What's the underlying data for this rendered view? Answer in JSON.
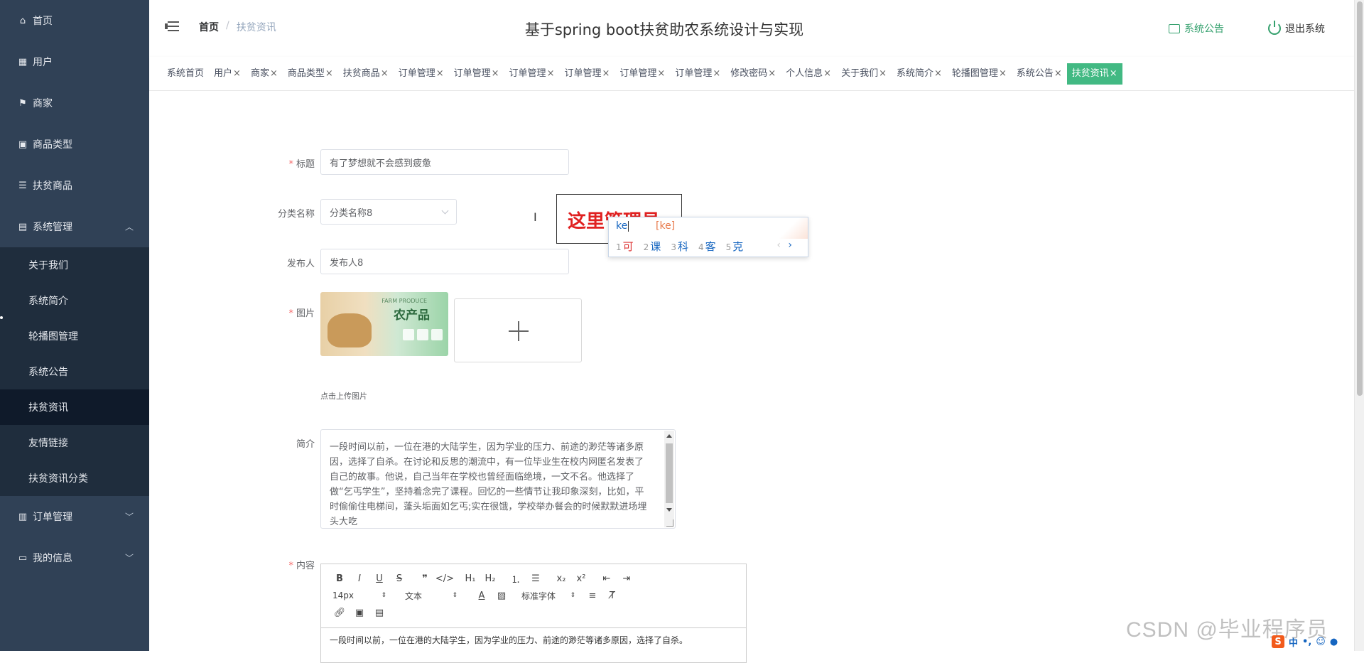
{
  "sidebar": {
    "items": [
      {
        "label": "首页",
        "icon": "home-icon"
      },
      {
        "label": "用户",
        "icon": "grid-icon"
      },
      {
        "label": "商家",
        "icon": "flag-icon"
      },
      {
        "label": "商品类型",
        "icon": "clipboard-icon"
      },
      {
        "label": "扶贫商品",
        "icon": "list-icon"
      },
      {
        "label": "系统管理",
        "icon": "document-icon"
      }
    ],
    "system_sub": [
      "关于我们",
      "系统简介",
      "轮播图管理",
      "系统公告",
      "扶贫资讯",
      "友情链接",
      "扶贫资讯分类"
    ],
    "order": {
      "label": "订单管理",
      "icon": "chart-icon"
    },
    "mine": {
      "label": "我的信息",
      "icon": "wallet-icon"
    }
  },
  "header": {
    "breadcrumb_home": "首页",
    "breadcrumb_sep": "/",
    "breadcrumb_current": "扶贫资讯",
    "title": "基于spring boot扶贫助农系统设计与实现",
    "notice": "系统公告",
    "logout": "退出系统"
  },
  "tabs": [
    {
      "label": "系统首页",
      "closable": false
    },
    {
      "label": "用户",
      "closable": true
    },
    {
      "label": "商家",
      "closable": true
    },
    {
      "label": "商品类型",
      "closable": true
    },
    {
      "label": "扶贫商品",
      "closable": true
    },
    {
      "label": "订单管理",
      "closable": true
    },
    {
      "label": "订单管理",
      "closable": true
    },
    {
      "label": "订单管理",
      "closable": true
    },
    {
      "label": "订单管理",
      "closable": true
    },
    {
      "label": "订单管理",
      "closable": true
    },
    {
      "label": "订单管理",
      "closable": true
    },
    {
      "label": "修改密码",
      "closable": true
    },
    {
      "label": "个人信息",
      "closable": true
    },
    {
      "label": "关于我们",
      "closable": true
    },
    {
      "label": "系统简介",
      "closable": true
    },
    {
      "label": "轮播图管理",
      "closable": true
    },
    {
      "label": "系统公告",
      "closable": true
    },
    {
      "label": "扶贫资讯",
      "closable": true,
      "active": true
    }
  ],
  "tab_close": "×",
  "form": {
    "required_mark": "*",
    "title_label": "标题",
    "title_value": "有了梦想就不会感到疲惫",
    "category_label": "分类名称",
    "category_value": "分类名称8",
    "publisher_label": "发布人",
    "publisher_value": "发布人8",
    "image_label": "图片",
    "image_thumb_title": "农产品",
    "image_thumb_sub": "FARM PRODUCE",
    "upload_hint": "点击上传图片",
    "intro_label": "简介",
    "intro_value": "一段时间以前，一位在港的大陆学生，因为学业的压力、前途的渺茫等诸多原因，选择了自杀。在讨论和反思的潮流中，有一位毕业生在校内网匿名发表了自己的故事。他说，自己当年在学校也曾经面临绝境，一文不名。他选择了做“乞丐学生”，坚持着念完了课程。回忆的一些情节让我印象深刻，比如，平时偷偷住电梯间，蓬头垢面如乞丐;实在很饿，学校举办餐会的时候默默进场埋头大吃",
    "content_label": "内容",
    "editor_font_size": "14px",
    "editor_block": "文本",
    "editor_font": "标准字体",
    "editor_body": "一段时间以前，一位在港的大陆学生，因为学业的压力、前途的渺茫等诸多原因，选择了自杀。"
  },
  "overlay": {
    "card_text": "这里管理员",
    "ime_typed": "ke",
    "ime_pinyin": "[ke]",
    "candidates": [
      {
        "n": "1",
        "c": "可"
      },
      {
        "n": "2",
        "c": "课"
      },
      {
        "n": "3",
        "c": "科"
      },
      {
        "n": "4",
        "c": "客"
      },
      {
        "n": "5",
        "c": "克"
      }
    ],
    "prev": "‹",
    "next": "›"
  },
  "watermark": "CSDN @毕业程序员",
  "tray": {
    "lang": "中",
    "punct": "•,"
  },
  "colors": {
    "sidebar_bg": "#304156",
    "accent": "#42b983",
    "required": "#f56c6c"
  }
}
